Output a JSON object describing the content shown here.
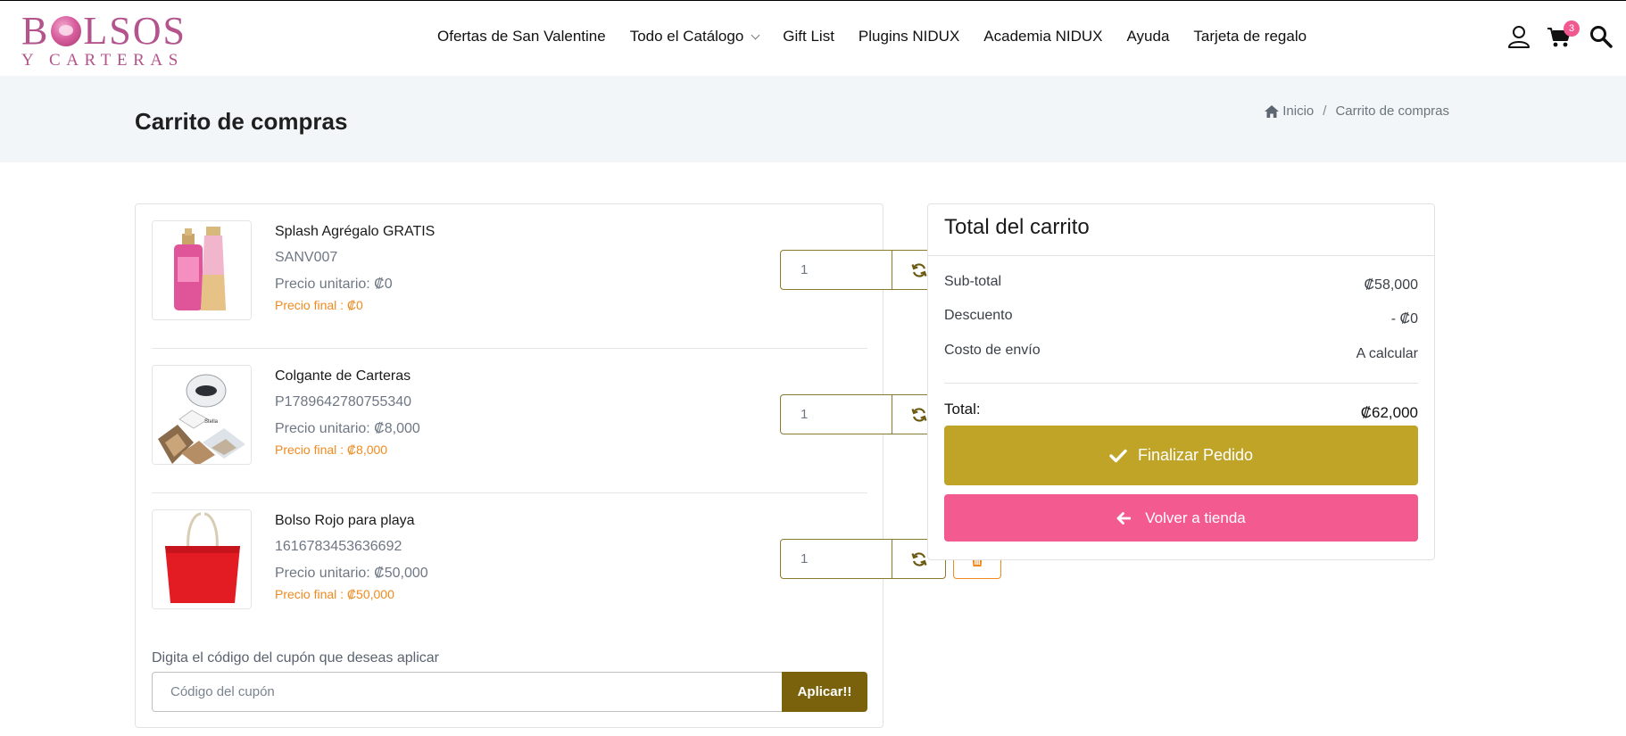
{
  "brand": {
    "logo_top_left": "B",
    "logo_top_right": "LSOS",
    "logo_bottom": "Y CARTERAS",
    "brand_color": "#b3548d"
  },
  "nav": {
    "items": [
      {
        "label": "Ofertas de San Valentine"
      },
      {
        "label": "Todo el Catálogo",
        "has_dropdown": true
      },
      {
        "label": "Gift List"
      },
      {
        "label": "Plugins NIDUX"
      },
      {
        "label": "Academia NIDUX"
      },
      {
        "label": "Ayuda"
      },
      {
        "label": "Tarjeta de regalo"
      }
    ],
    "icons": [
      "user-icon",
      "cart-icon",
      "search-icon"
    ],
    "cart_count": "3",
    "badge_color": "#f0588f"
  },
  "page": {
    "title": "Carrito de compras",
    "breadcrumb": {
      "home": "Inicio",
      "separator": "/",
      "current": "Carrito de compras"
    }
  },
  "cart": {
    "items": [
      {
        "name": "Splash Agrégalo GRATIS",
        "sku": "SANV007",
        "unit_price": "Precio unitario: ₡0",
        "final_price": "Precio final : ₡0",
        "quantity": "1",
        "image_icon": "perfume-image"
      },
      {
        "name": "Colgante de Carteras",
        "sku": "P1789642780755340",
        "unit_price": "Precio unitario: ₡8,000",
        "final_price": "Precio final : ₡8,000",
        "quantity": "1",
        "image_icon": "bag-hanger-image"
      },
      {
        "name": "Bolso Rojo para playa",
        "sku": "1616783453636692",
        "unit_price": "Precio unitario: ₡50,000",
        "final_price": "Precio final : ₡50,000",
        "quantity": "1",
        "image_icon": "red-bag-image"
      }
    ],
    "coupon": {
      "label": "Digita el código del cupón que deseas aplicar",
      "placeholder": "Código del cupón",
      "button": "Aplicar!!"
    },
    "accent_color": "#8a7a2e",
    "delete_color": "#f08a1e"
  },
  "totals": {
    "title": "Total del carrito",
    "subtotal_label": "Sub-total",
    "subtotal_value": "₡58,000",
    "discount_label": "Descuento",
    "discount_value": "- ₡0",
    "shipping_label": "Costo de envío",
    "shipping_value": "A calcular",
    "total_label": "Total:",
    "total_value": "₡62,000",
    "finalize_button": "Finalizar Pedido",
    "back_button": "Volver a tienda",
    "finalize_color": "#bfa428",
    "back_color": "#f35a8f"
  }
}
